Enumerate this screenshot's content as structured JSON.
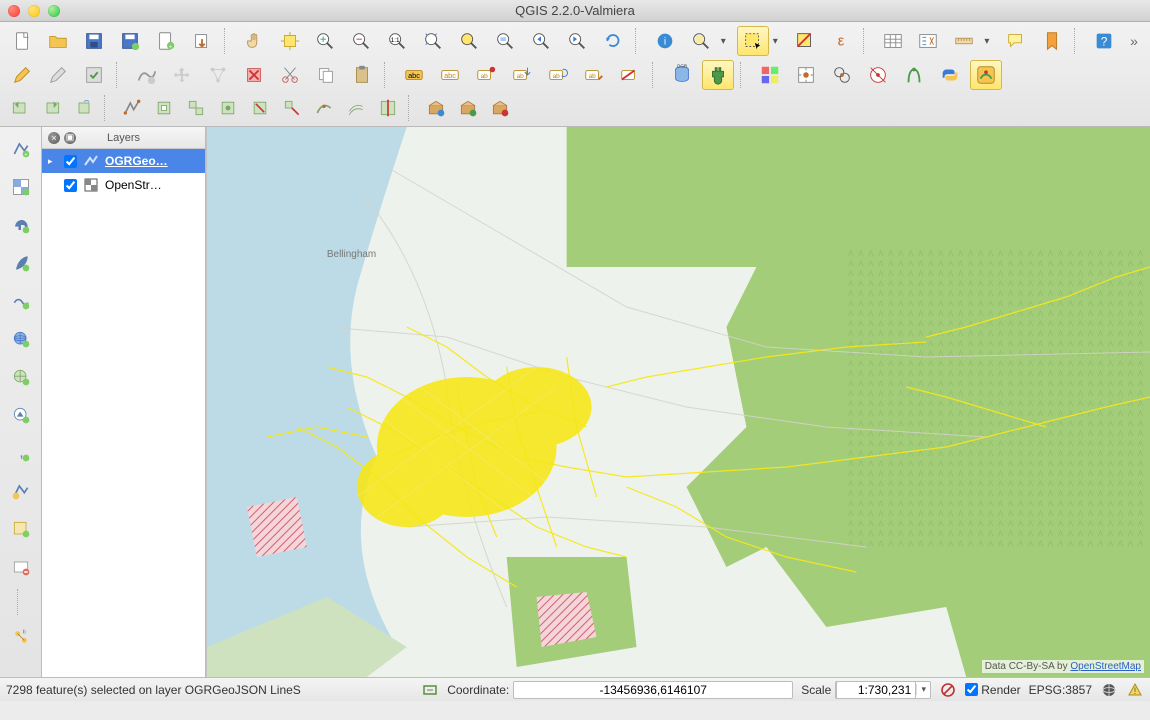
{
  "window": {
    "title": "QGIS 2.2.0-Valmiera"
  },
  "layers_panel": {
    "title": "Layers",
    "items": [
      {
        "name": "OGRGeo…",
        "checked": true,
        "selected": true,
        "type": "line"
      },
      {
        "name": "OpenStr…",
        "checked": true,
        "selected": false,
        "type": "raster"
      }
    ]
  },
  "status": {
    "selection_msg": "7298 feature(s) selected on layer OGRGeoJSON LineS",
    "coord_label": "Coordinate:",
    "coord_value": "-13456936,6146107",
    "scale_label": "Scale",
    "scale_value": "1:730,231",
    "render_label": "Render",
    "crs_label": "EPSG:3857"
  },
  "map": {
    "attribution_prefix": "Data CC-By-SA by ",
    "attribution_link": "OpenStreetMap",
    "labels": {
      "bellingham": "Bellingham"
    }
  },
  "toolbar_row1": [
    {
      "n": "new-project-icon",
      "t": "doc"
    },
    {
      "n": "open-project-icon",
      "t": "folder"
    },
    {
      "n": "save-project-icon",
      "t": "floppy"
    },
    {
      "n": "save-as-icon",
      "t": "floppy2"
    },
    {
      "n": "new-print-composer-icon",
      "t": "doc2"
    },
    {
      "n": "composer-manager-icon",
      "t": "export"
    },
    {
      "n": "sep"
    },
    {
      "n": "pan-icon",
      "t": "hand"
    },
    {
      "n": "pan-to-selection-icon",
      "t": "pansel"
    },
    {
      "n": "zoom-in-icon",
      "t": "zoomin"
    },
    {
      "n": "zoom-out-icon",
      "t": "zoomout"
    },
    {
      "n": "zoom-native-icon",
      "t": "zoom1"
    },
    {
      "n": "zoom-full-icon",
      "t": "zoomfull"
    },
    {
      "n": "zoom-selection-icon",
      "t": "zoomsel"
    },
    {
      "n": "zoom-layer-icon",
      "t": "zoomlayer"
    },
    {
      "n": "zoom-last-icon",
      "t": "zoomlast"
    },
    {
      "n": "zoom-next-icon",
      "t": "zoomnext"
    },
    {
      "n": "refresh-icon",
      "t": "refresh"
    },
    {
      "n": "sep"
    },
    {
      "n": "identify-icon",
      "t": "identify"
    },
    {
      "n": "select-icon",
      "t": "selectmag",
      "dd": true
    },
    {
      "n": "select-rect-icon",
      "t": "selectrect",
      "active": true,
      "dd": true
    },
    {
      "n": "deselect-icon",
      "t": "deselect"
    },
    {
      "n": "expression-select-icon",
      "t": "expr"
    },
    {
      "n": "sep"
    },
    {
      "n": "attribute-table-icon",
      "t": "table"
    },
    {
      "n": "field-calc-icon",
      "t": "fieldcalc"
    },
    {
      "n": "measure-icon",
      "t": "measure",
      "dd": true
    },
    {
      "n": "map-tips-icon",
      "t": "tip"
    },
    {
      "n": "bookmark-icon",
      "t": "bookmark"
    },
    {
      "n": "sep"
    },
    {
      "n": "help-icon",
      "t": "help"
    },
    {
      "n": "more",
      "t": "more"
    }
  ],
  "toolbar_row2": [
    {
      "n": "toggle-edit-icon",
      "t": "pencil"
    },
    {
      "n": "edit-icon",
      "t": "pencil2"
    },
    {
      "n": "save-edits-icon",
      "t": "saveedit"
    },
    {
      "n": "sep"
    },
    {
      "n": "add-feature-icon",
      "t": "addfeat"
    },
    {
      "n": "move-feature-icon",
      "t": "movefeat"
    },
    {
      "n": "node-tool-icon",
      "t": "node"
    },
    {
      "n": "delete-selected-icon",
      "t": "delete"
    },
    {
      "n": "cut-features-icon",
      "t": "cut"
    },
    {
      "n": "copy-features-icon",
      "t": "copy"
    },
    {
      "n": "paste-features-icon",
      "t": "paste"
    },
    {
      "n": "sep"
    },
    {
      "n": "label-icon",
      "t": "label",
      "bg": "#ffe66e"
    },
    {
      "n": "label-settings-icon",
      "t": "label2"
    },
    {
      "n": "label-pin-icon",
      "t": "label3"
    },
    {
      "n": "label-move-icon",
      "t": "label4"
    },
    {
      "n": "label-rotate-icon",
      "t": "label5"
    },
    {
      "n": "label-change-icon",
      "t": "label6"
    },
    {
      "n": "label-hide-icon",
      "t": "label7"
    },
    {
      "n": "sep"
    },
    {
      "n": "db-manager-icon",
      "t": "db"
    },
    {
      "n": "plugin-icon",
      "t": "plug",
      "active": true
    },
    {
      "n": "sep"
    },
    {
      "n": "raster-calc-icon",
      "t": "rcalc"
    },
    {
      "n": "georef-icon",
      "t": "georef"
    },
    {
      "n": "analysis-icon",
      "t": "analysis"
    },
    {
      "n": "gps-icon",
      "t": "gps"
    },
    {
      "n": "grass-icon",
      "t": "grass"
    },
    {
      "n": "python-icon",
      "t": "python"
    },
    {
      "n": "osm-icon",
      "t": "osm",
      "active": true
    }
  ],
  "toolbar_row3": [
    {
      "n": "undo-icon",
      "t": "undo"
    },
    {
      "n": "redo-icon",
      "t": "redo"
    },
    {
      "n": "rotate-feature-icon",
      "t": "rotf"
    },
    {
      "n": "sep"
    },
    {
      "n": "simplify-icon",
      "t": "simplify"
    },
    {
      "n": "add-ring-icon",
      "t": "ring"
    },
    {
      "n": "add-part-icon",
      "t": "part"
    },
    {
      "n": "fill-ring-icon",
      "t": "fill"
    },
    {
      "n": "delete-ring-icon",
      "t": "dring"
    },
    {
      "n": "delete-part-icon",
      "t": "dpart"
    },
    {
      "n": "reshape-icon",
      "t": "reshape"
    },
    {
      "n": "offset-curve-icon",
      "t": "offset"
    },
    {
      "n": "split-features-icon",
      "t": "split"
    },
    {
      "n": "sep"
    },
    {
      "n": "package-icon",
      "t": "pkg"
    },
    {
      "n": "package2-icon",
      "t": "pkg2"
    },
    {
      "n": "package3-icon",
      "t": "pkg3"
    }
  ],
  "left_rail": [
    {
      "n": "add-vector-layer-icon",
      "t": "vpoint"
    },
    {
      "n": "add-raster-layer-icon",
      "t": "raster"
    },
    {
      "n": "add-postgis-layer-icon",
      "t": "elephant"
    },
    {
      "n": "add-spatialite-layer-icon",
      "t": "feather"
    },
    {
      "n": "add-mssql-layer-icon",
      "t": "wave"
    },
    {
      "n": "add-wms-layer-icon",
      "t": "globe"
    },
    {
      "n": "add-wcs-layer-icon",
      "t": "globe2"
    },
    {
      "n": "add-wfs-layer-icon",
      "t": "vec"
    },
    {
      "n": "add-delimited-text-icon",
      "t": "comma"
    },
    {
      "n": "new-vector-layer-icon",
      "t": "vline"
    },
    {
      "n": "new-spatialite-icon",
      "t": "newsl"
    },
    {
      "n": "remove-layer-icon",
      "t": "remove"
    },
    {
      "n": "sep"
    },
    {
      "n": "gps-info-icon",
      "t": "satnode"
    }
  ]
}
